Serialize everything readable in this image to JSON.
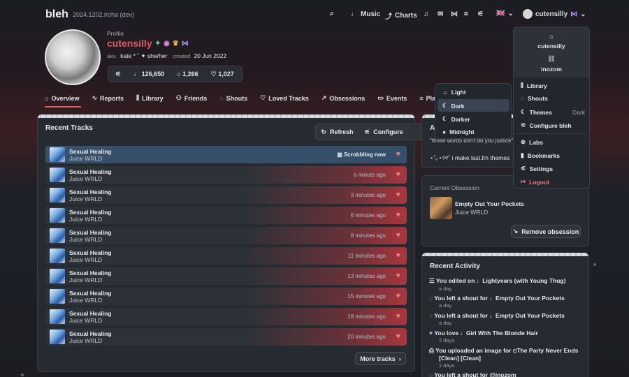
{
  "app": {
    "logo": "bleh",
    "version": "2024.1202.iroha (dev)"
  },
  "topnav": {
    "music": "Music",
    "charts": "Charts",
    "username": "cutensilly",
    "lang_flag": "🇬🇧"
  },
  "profile": {
    "section_label": "Profile",
    "display_name": "cutensilly",
    "aka_label": "aka.",
    "aka_value": "kate * ˚ ✦ she/her",
    "created_label": "created",
    "created_value": "20 Jun 2022",
    "stats": {
      "scrobbles": "126,650",
      "artists": "1,266",
      "loved": "1,027"
    }
  },
  "tabs": [
    "Overview",
    "Reports",
    "Library",
    "Friends",
    "Shouts",
    "Loved Tracks",
    "Obsessions",
    "Events",
    "Playlists"
  ],
  "recent_tracks": {
    "title": "Recent Tracks",
    "refresh": "Refresh",
    "configure": "Configure",
    "more": "More tracks",
    "items": [
      {
        "name": "Sexual Healing",
        "artist": "Juice WRLD",
        "time": "Scrobbling now"
      },
      {
        "name": "Sexual Healing",
        "artist": "Juice WRLD",
        "time": "a minute ago"
      },
      {
        "name": "Sexual Healing",
        "artist": "Juice WRLD",
        "time": "3 minutes ago"
      },
      {
        "name": "Sexual Healing",
        "artist": "Juice WRLD",
        "time": "6 minutes ago"
      },
      {
        "name": "Sexual Healing",
        "artist": "Juice WRLD",
        "time": "8 minutes ago"
      },
      {
        "name": "Sexual Healing",
        "artist": "Juice WRLD",
        "time": "11 minutes ago"
      },
      {
        "name": "Sexual Healing",
        "artist": "Juice WRLD",
        "time": "13 minutes ago"
      },
      {
        "name": "Sexual Healing",
        "artist": "Juice WRLD",
        "time": "15 minutes ago"
      },
      {
        "name": "Sexual Healing",
        "artist": "Juice WRLD",
        "time": "18 minutes ago"
      },
      {
        "name": "Sexual Healing",
        "artist": "Juice WRLD",
        "time": "20 minutes ago"
      }
    ]
  },
  "about": {
    "title_initial": "A",
    "quote": "\"those words don't do you justice\"",
    "line": "⋆˚｡⋆୨୧˚ i make last.fm themes"
  },
  "theme_menu": {
    "items": [
      "Light",
      "Dark",
      "Darker",
      "Midnight"
    ],
    "selected": "Dark"
  },
  "user_menu": {
    "user1": "cutensilly",
    "user2": "inozom",
    "library": "Library",
    "shouts": "Shouts",
    "themes": "Themes",
    "themes_value": "Dark",
    "configure": "Configure bleh",
    "labs": "Labs",
    "bookmarks": "Bookmarks",
    "settings": "Settings",
    "logout": "Logout"
  },
  "obsession": {
    "label": "Current Obsession",
    "track": "Empty Out Your Pockets",
    "artist": "Juice WRLD",
    "remove": "Remove obsession"
  },
  "activity": {
    "title": "Recent Activity",
    "items": [
      {
        "prefix": "You edited on",
        "target": "Lightyears (with Young Thug)",
        "time": "a day"
      },
      {
        "prefix": "You left a shout for",
        "target": "Empty Out Your Pockets",
        "time": "a day"
      },
      {
        "prefix": "You left a shout for",
        "target": "Empty Out Your Pockets",
        "time": "a day"
      },
      {
        "prefix": "You love",
        "target": "Girl With The Blonde Hair",
        "time": "2 days"
      },
      {
        "prefix": "You uploaded an image for",
        "target": "The Party Never Ends",
        "target2": "[Clean] [Clean]",
        "time": "2 days"
      },
      {
        "prefix": "You left a shout for",
        "target": "@inozom",
        "time": ""
      }
    ]
  },
  "colors": {
    "accent": "#e05a64",
    "love": "#f07a82",
    "purple": "#b490f5"
  }
}
